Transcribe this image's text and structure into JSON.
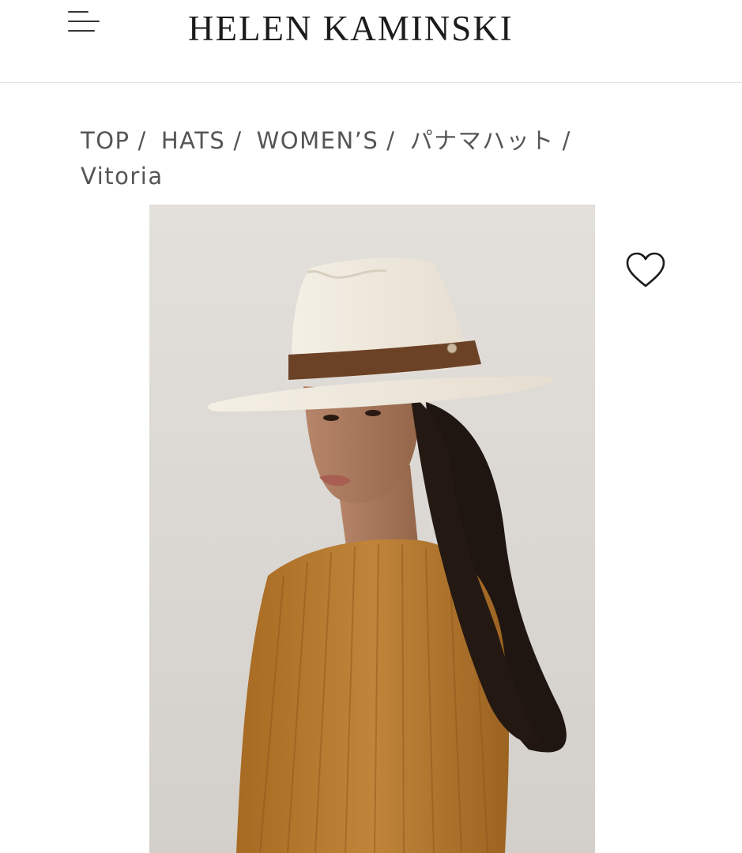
{
  "header": {
    "brand": "HELEN KAMINSKI",
    "menu_icon": "hamburger-menu-icon"
  },
  "breadcrumb": {
    "items": [
      "TOP",
      "HATS",
      "WOMEN’S",
      "パナマハット"
    ],
    "separator": "/",
    "current": "Vitoria"
  },
  "product": {
    "favorite_icon": "heart-outline-icon"
  },
  "colors": {
    "background": "#ffffff",
    "photo_backdrop": "#dedbd6",
    "hat": "#f1ebdf",
    "hat_band": "#6b4226",
    "sweater": "#b87a2e",
    "hair": "#1f1611",
    "skin": "#a8795a",
    "text": "#555555"
  }
}
